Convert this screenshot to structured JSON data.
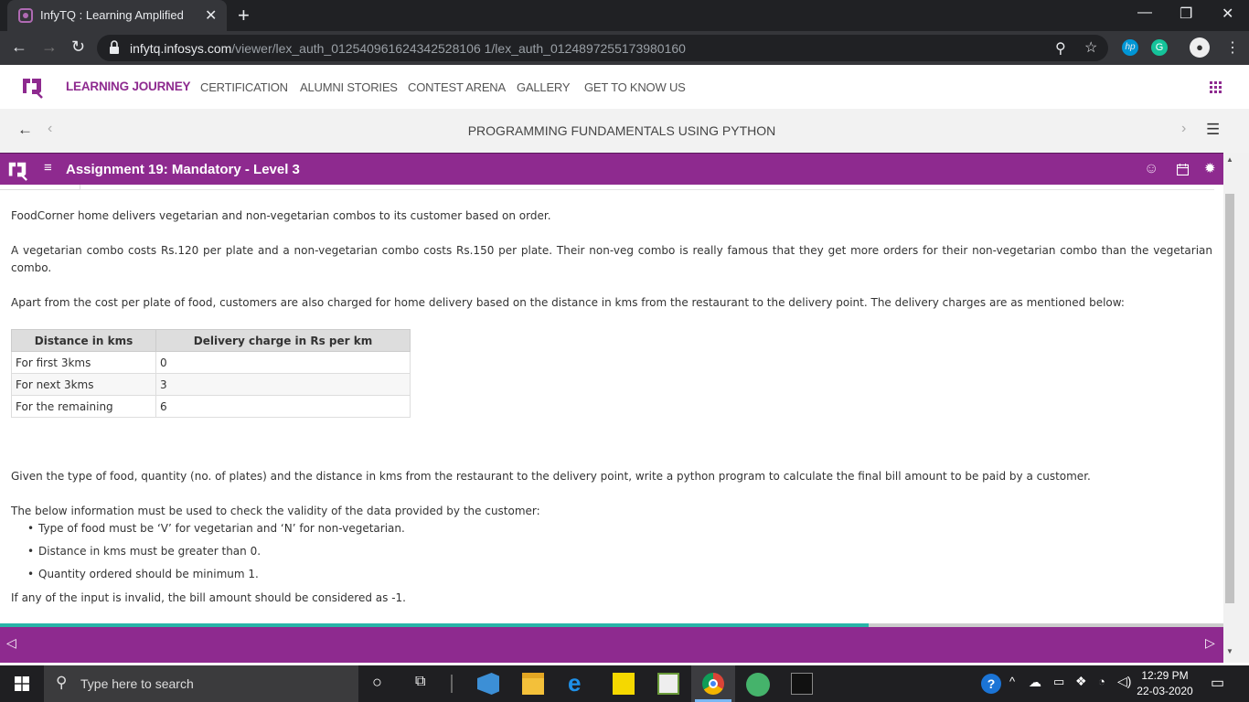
{
  "browser": {
    "tab_title": "InfyTQ : Learning Amplified",
    "url_host": "infytq.infosys.com",
    "url_path": "/viewer/lex_auth_012540961624342528106 1/lex_auth_0124897255173980160"
  },
  "site_nav": {
    "items": [
      "LEARNING JOURNEY",
      "CERTIFICATION",
      "ALUMNI STORIES",
      "CONTEST ARENA",
      "GALLERY",
      "GET TO KNOW US"
    ],
    "active": "LEARNING JOURNEY"
  },
  "course": {
    "title": "PROGRAMMING FUNDAMENTALS USING PYTHON"
  },
  "assignment": {
    "title": "Assignment 19: Mandatory - Level 3"
  },
  "content": {
    "p1": "FoodCorner home delivers vegetarian and non-vegetarian combos to its customer based on order.",
    "p2": "A vegetarian combo costs Rs.120 per plate and a non-vegetarian combo costs Rs.150 per plate. Their non-veg combo is really famous that they get more orders for their non-vegetarian combo than the vegetarian combo.",
    "p3": "Apart from the cost per plate of food, customers are also charged for home delivery based on the distance in kms from the restaurant to the delivery point. The delivery charges are as mentioned below:",
    "table": {
      "headers": [
        "Distance in kms",
        "Delivery charge in Rs per km"
      ],
      "rows": [
        [
          "For first 3kms",
          "0"
        ],
        [
          "For next 3kms",
          "3"
        ],
        [
          "For the remaining",
          "6"
        ]
      ]
    },
    "p4": "Given the type of food, quantity (no. of plates) and the distance in kms from the restaurant to the delivery point, write a python program to calculate the final bill amount to be paid by a customer.",
    "p5": "The below information must be used to check the validity of the data provided by the customer:",
    "rules": [
      "Type of food must be ‘V’ for vegetarian and ‘N’ for non-vegetarian.",
      "Distance in kms must be greater than 0.",
      "Quantity ordered should be minimum 1."
    ],
    "p6": "If any of the input is invalid, the bill amount should be considered as -1."
  },
  "progress": {
    "fraction": 0.71
  },
  "taskbar": {
    "search_placeholder": "Type here to search",
    "time": "12:29 PM",
    "date": "22-03-2020"
  },
  "colors": {
    "brand": "#8e2a8f",
    "progress": "#28b5a8"
  }
}
